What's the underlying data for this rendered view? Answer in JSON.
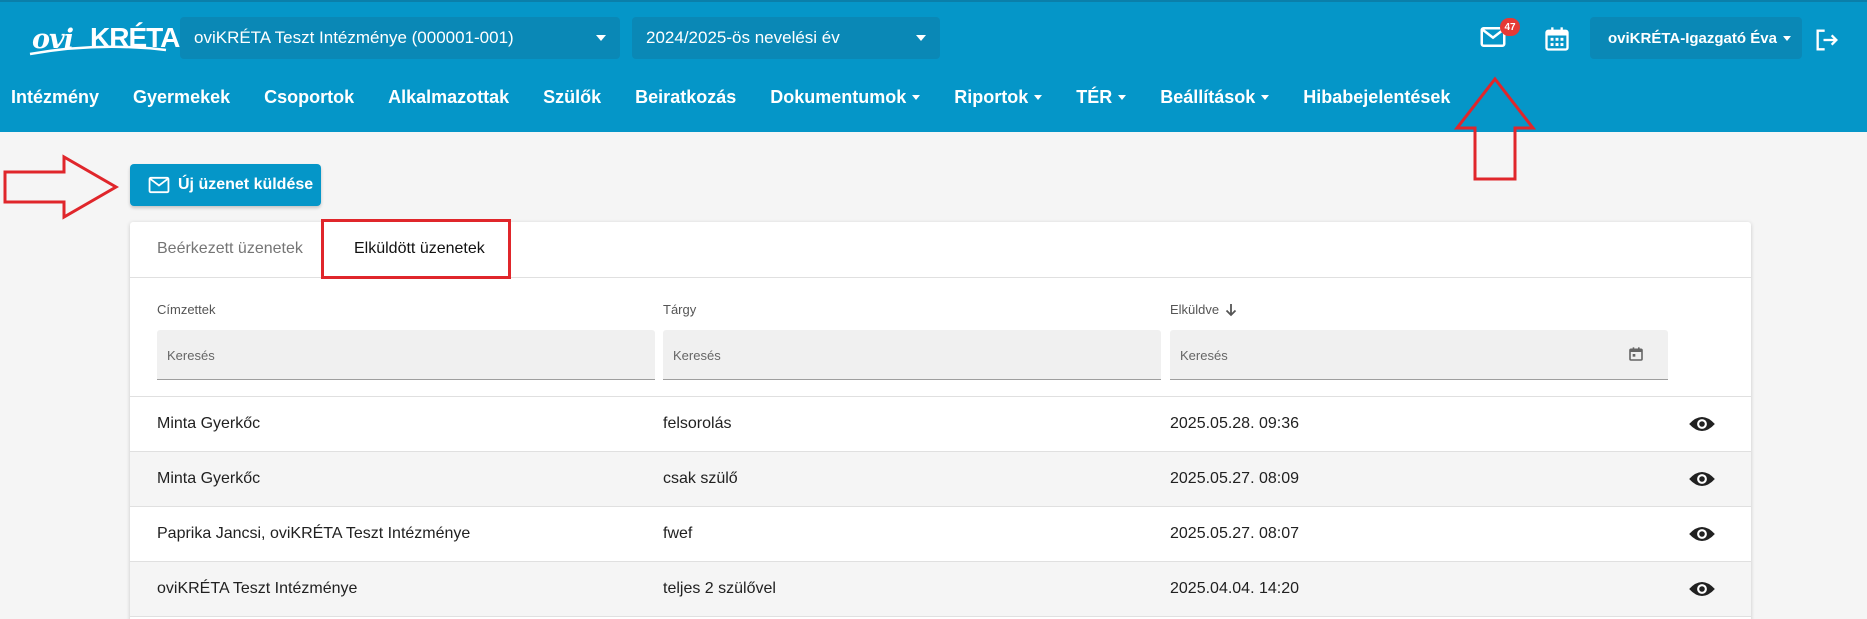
{
  "header": {
    "logo": {
      "ovi": "ovi",
      "kreta": "KRÉTA"
    },
    "institution_select": "oviKRÉTA Teszt Intézménye (000001-001)",
    "year_select": "2024/2025-ös nevelési év",
    "message_count": "47",
    "user_name": "oviKRÉTA-Igazgató Éva"
  },
  "nav": {
    "items": [
      {
        "label": "Intézmény",
        "dropdown": false
      },
      {
        "label": "Gyermekek",
        "dropdown": false
      },
      {
        "label": "Csoportok",
        "dropdown": false
      },
      {
        "label": "Alkalmazottak",
        "dropdown": false
      },
      {
        "label": "Szülők",
        "dropdown": false
      },
      {
        "label": "Beiratkozás",
        "dropdown": false
      },
      {
        "label": "Dokumentumok",
        "dropdown": true
      },
      {
        "label": "Riportok",
        "dropdown": true
      },
      {
        "label": "TÉR",
        "dropdown": true
      },
      {
        "label": "Beállítások",
        "dropdown": true
      },
      {
        "label": "Hibabejelentések",
        "dropdown": false
      }
    ]
  },
  "new_message_button": "Új üzenet küldése",
  "tabs": {
    "inbox": "Beérkezett üzenetek",
    "sent": "Elküldött üzenetek"
  },
  "table": {
    "columns": {
      "recipients": "Címzettek",
      "subject": "Tárgy",
      "sent": "Elküldve"
    },
    "filter_placeholder": "Keresés",
    "rows": [
      {
        "recipients": "Minta Gyerkőc",
        "subject": "felsorolás",
        "sent": "2025.05.28. 09:36"
      },
      {
        "recipients": "Minta Gyerkőc",
        "subject": "csak szülő",
        "sent": "2025.05.27. 08:09"
      },
      {
        "recipients": "Paprika Jancsi, oviKRÉTA Teszt Intézménye",
        "subject": "fwef",
        "sent": "2025.05.27. 08:07"
      },
      {
        "recipients": "oviKRÉTA Teszt Intézménye",
        "subject": "teljes 2 szülővel",
        "sent": "2025.04.04. 14:20"
      }
    ]
  },
  "colors": {
    "primary": "#0596c8",
    "annotation": "#e0262b",
    "badge": "#e53935"
  },
  "icons": [
    "mail-icon",
    "calendar-icon",
    "logout-icon",
    "eye-icon",
    "sort-down-arrow-icon"
  ]
}
